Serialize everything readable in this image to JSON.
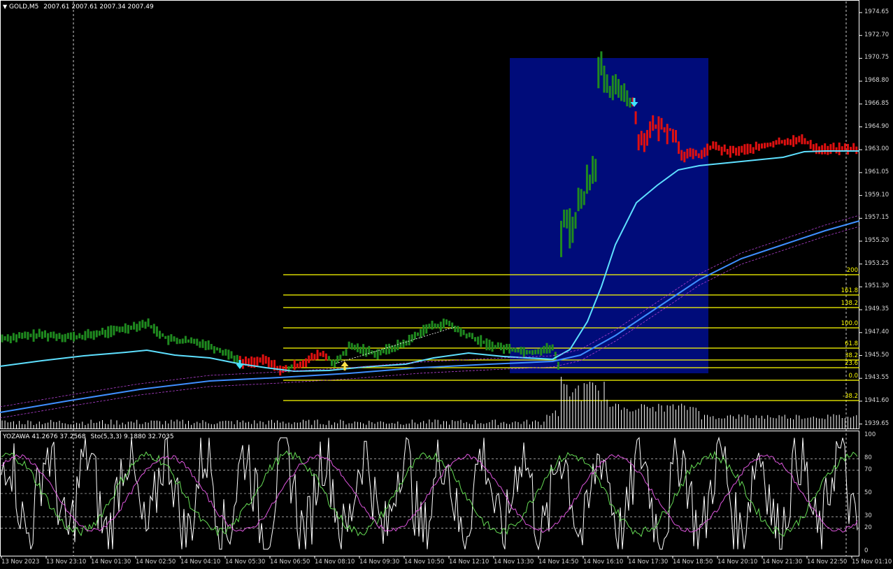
{
  "main_header": {
    "symbol": "GOLD,M5",
    "ohlc": "2007.61 2007.61 2007.34 2007.49"
  },
  "sub_header": {
    "indicator": "YOZAWA 41.2676 37.2568",
    "stochastic": "Sto(5,3,3) 9.1880 32.7035"
  },
  "price_axis": [
    "1974.65",
    "1972.70",
    "1970.75",
    "1968.80",
    "1966.85",
    "1964.90",
    "1963.00",
    "1961.05",
    "1959.10",
    "1957.15",
    "1955.20",
    "1953.25",
    "1951.30",
    "1949.35",
    "1947.40",
    "1945.50",
    "1943.55",
    "1941.60",
    "1939.65"
  ],
  "osc_axis": [
    "100",
    "80",
    "70",
    "50",
    "30",
    "20",
    "0"
  ],
  "time_axis": [
    "13 Nov 2023",
    "13 Nov 23:10",
    "14 Nov 01:30",
    "14 Nov 02:50",
    "14 Nov 04:10",
    "14 Nov 05:30",
    "14 Nov 06:50",
    "14 Nov 08:10",
    "14 Nov 09:30",
    "14 Nov 10:50",
    "14 Nov 12:10",
    "14 Nov 13:30",
    "14 Nov 14:50",
    "14 Nov 16:10",
    "14 Nov 17:30",
    "14 Nov 18:50",
    "14 Nov 20:10",
    "14 Nov 21:30",
    "14 Nov 22:50",
    "15 Nov 01:10"
  ],
  "fib_levels": [
    "200",
    "161.8",
    "138.2",
    "100.0",
    "61.8",
    "38.2",
    "23.6",
    "0.0",
    "-38.2"
  ],
  "colors": {
    "background": "#000000",
    "bull_bar": "#1f8a1f",
    "bear_bar": "#e01010",
    "fast_ma": "#5ee0ff",
    "slow_ma": "#3f8fff",
    "fib_line": "#ffff00",
    "zone": "#000c7a",
    "up_arrow": "#ffe14a",
    "down_arrow": "#3fe6ff"
  }
}
